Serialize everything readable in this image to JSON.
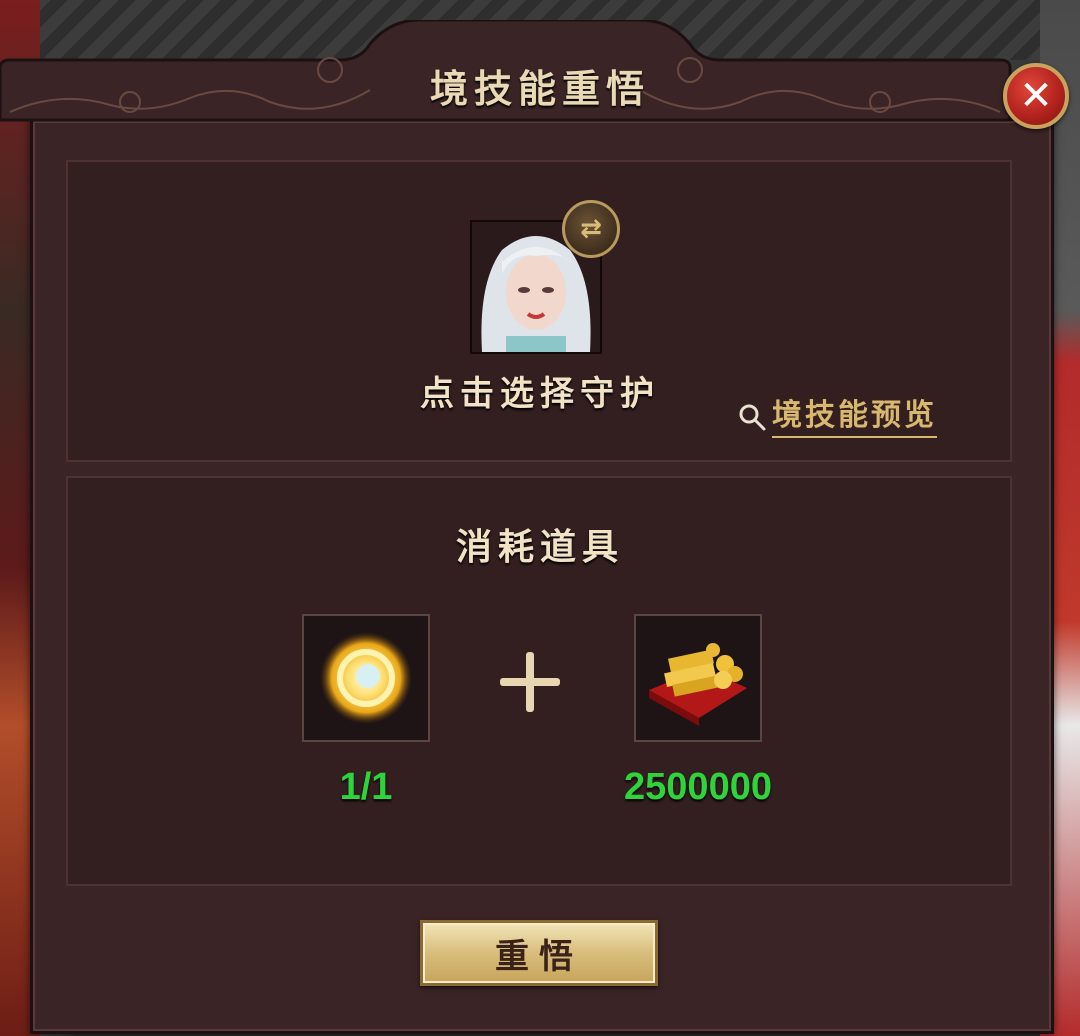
{
  "dialog": {
    "title": "境技能重悟",
    "close_icon": "close-icon"
  },
  "guardian": {
    "select_text": "点击选择守护",
    "swap_icon": "swap-icon",
    "preview_label": "境技能预览",
    "preview_icon": "search-icon"
  },
  "consume": {
    "title": "消耗道具",
    "items": [
      {
        "icon": "golden-orb-icon",
        "count": "1/1"
      },
      {
        "icon": "gold-ingots-icon",
        "count": "2500000"
      }
    ],
    "count_color": "#2fd43a"
  },
  "actions": {
    "confirm_label": "重悟"
  }
}
